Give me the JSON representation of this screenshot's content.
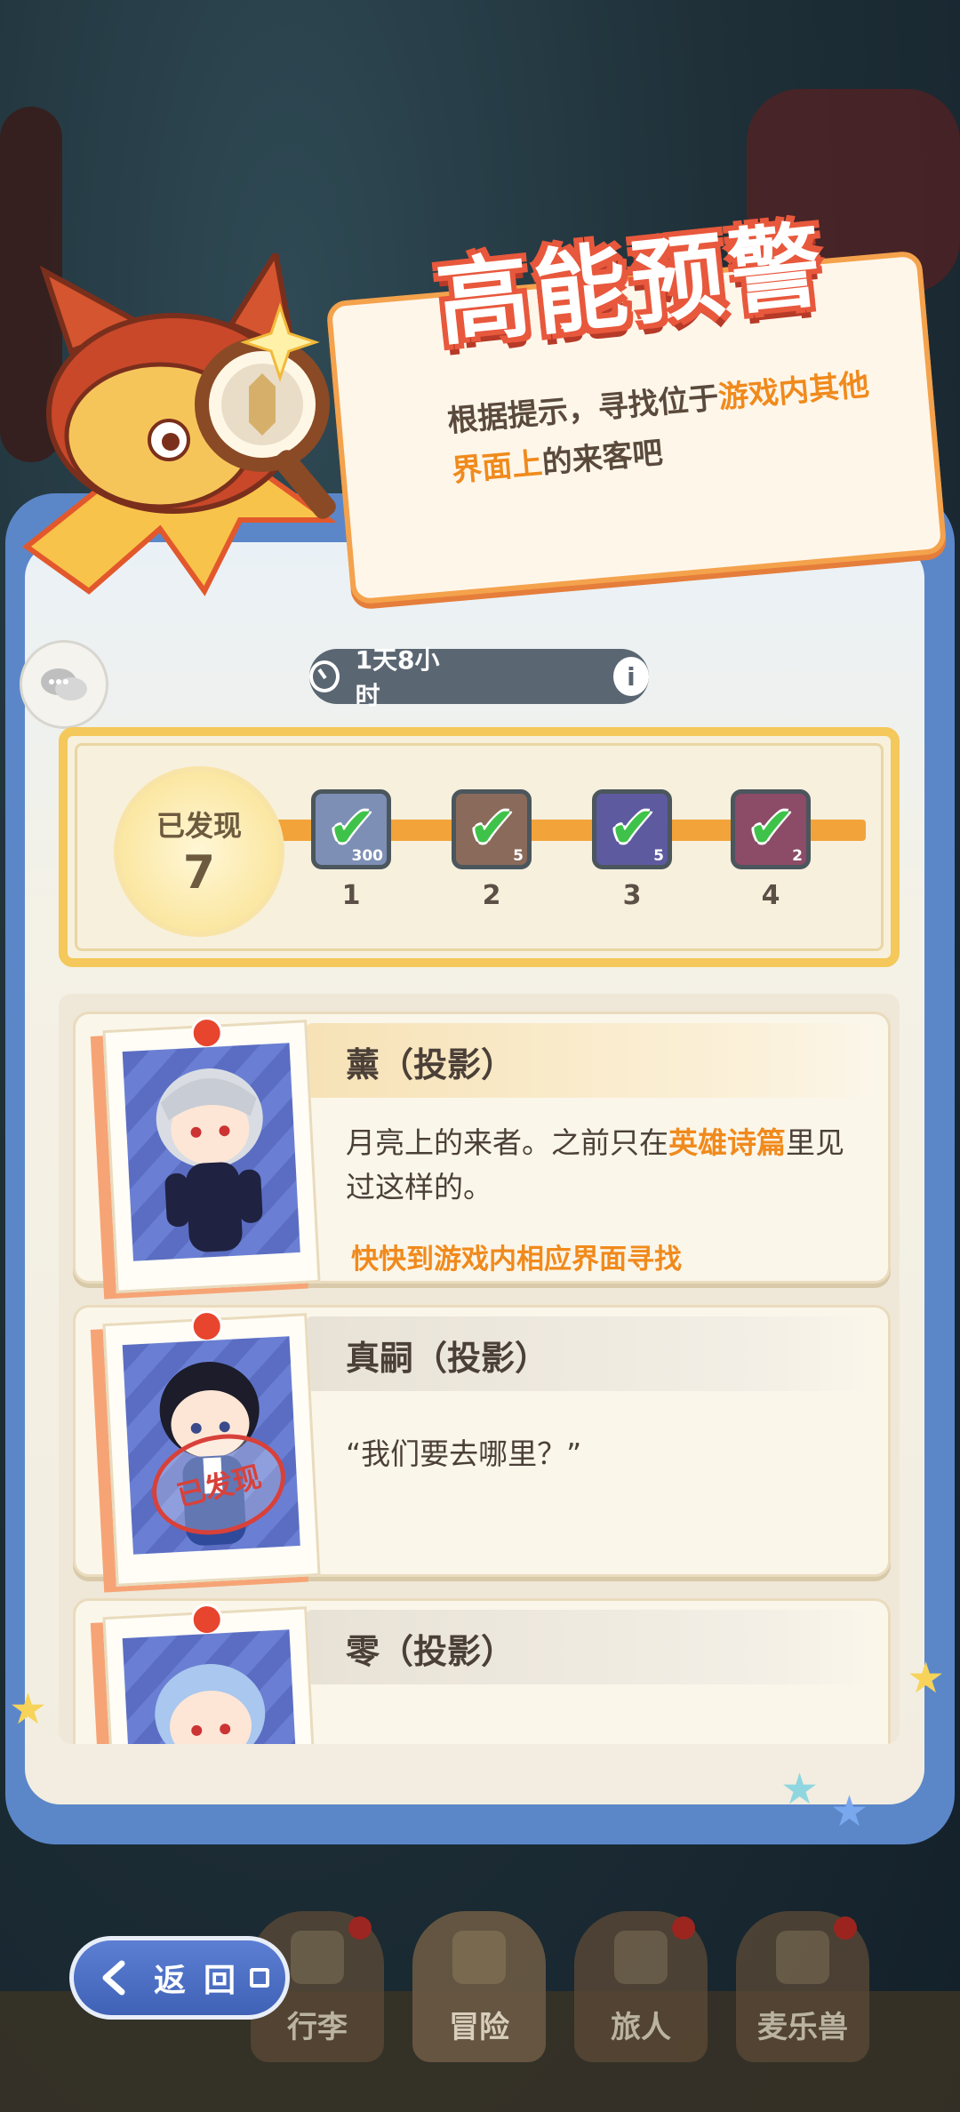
{
  "event": {
    "title": "高能预警",
    "hint_part1": "根据提示，寻找位于",
    "hint_highlight": "游戏内其他界面上",
    "hint_part2": "的来客吧",
    "timer": "1天8小时"
  },
  "progress": {
    "found_label": "已发现",
    "found_count": "7",
    "rewards": [
      {
        "index": "1",
        "qty": "300",
        "claimed": true
      },
      {
        "index": "2",
        "qty": "5",
        "claimed": true
      },
      {
        "index": "3",
        "qty": "5",
        "claimed": true
      },
      {
        "index": "4",
        "qty": "2",
        "claimed": true
      }
    ]
  },
  "visitors": [
    {
      "name": "薰（投影）",
      "desc_part1": "月亮上的来者。之前只在",
      "desc_highlight": "英雄诗篇",
      "desc_part2": "里见过这样的。",
      "action": "快快到游戏内相应界面寻找",
      "found": false
    },
    {
      "name": "真嗣（投影）",
      "desc": "“我们要去哪里？”",
      "stamp": "已发现",
      "found": true
    },
    {
      "name": "零（投影）",
      "found": false
    }
  ],
  "nav": {
    "back_label": "返回",
    "tabs": [
      "行李",
      "冒险",
      "旅人",
      "麦乐兽"
    ]
  },
  "colors": {
    "accent_orange": "#f08a1c",
    "panel_blue": "#5b87c9",
    "check_green": "#3fc24a",
    "badge_red": "#c8251b"
  }
}
